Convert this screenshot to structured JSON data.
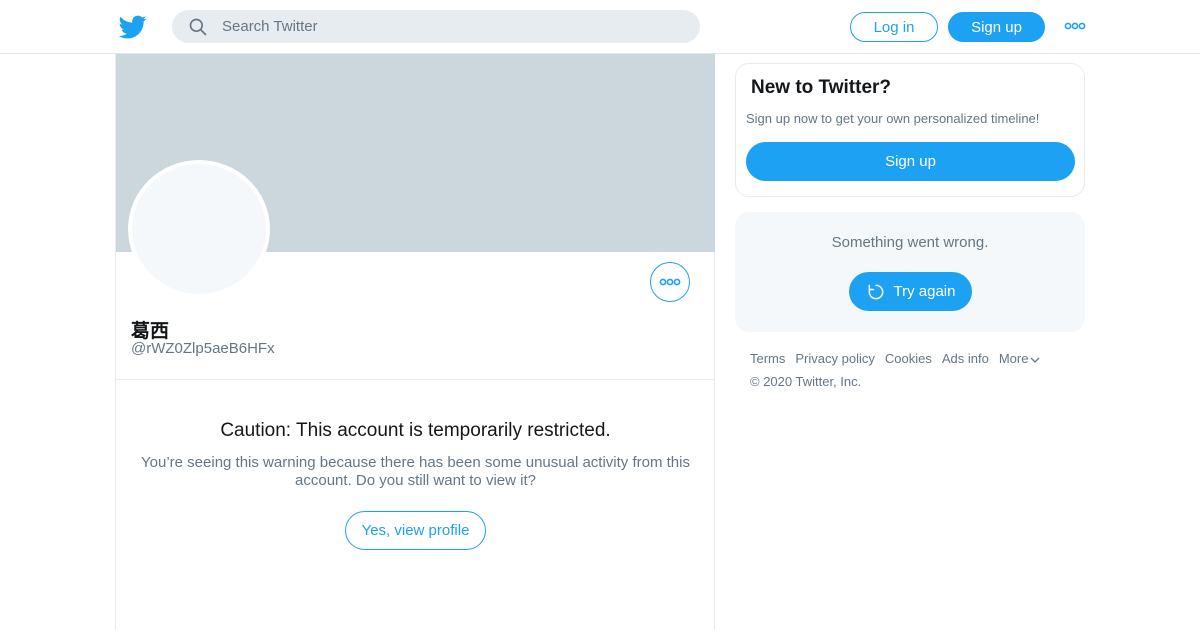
{
  "header": {
    "logo_icon": "twitter-bird-icon",
    "search_placeholder": "Search Twitter",
    "login_label": "Log in",
    "signup_label": "Sign up",
    "more_icon": "more-dots-icon"
  },
  "profile": {
    "display_name": "葛西",
    "handle": "@rWZ0Zlp5aeB6HFx",
    "more_icon": "more-dots-icon"
  },
  "warning": {
    "title": "Caution: This account is temporarily restricted.",
    "text": "You’re seeing this warning because there has been some unusual activity from this account. Do you still want to view it?",
    "button_label": "Yes, view profile"
  },
  "sidebar": {
    "new_title": "New to Twitter?",
    "new_subtitle": "Sign up now to get your own personalized timeline!",
    "new_button": "Sign up",
    "error_message": "Something went wrong.",
    "retry_label": "Try again",
    "retry_icon": "refresh-icon"
  },
  "footer": {
    "links": [
      "Terms",
      "Privacy policy",
      "Cookies",
      "Ads info",
      "More"
    ],
    "copyright": "© 2020 Twitter, Inc."
  },
  "colors": {
    "accent": "#1da1f2",
    "banner": "#ccd6dd",
    "muted_text": "#657786",
    "panel_bg": "#f5f8fa"
  }
}
